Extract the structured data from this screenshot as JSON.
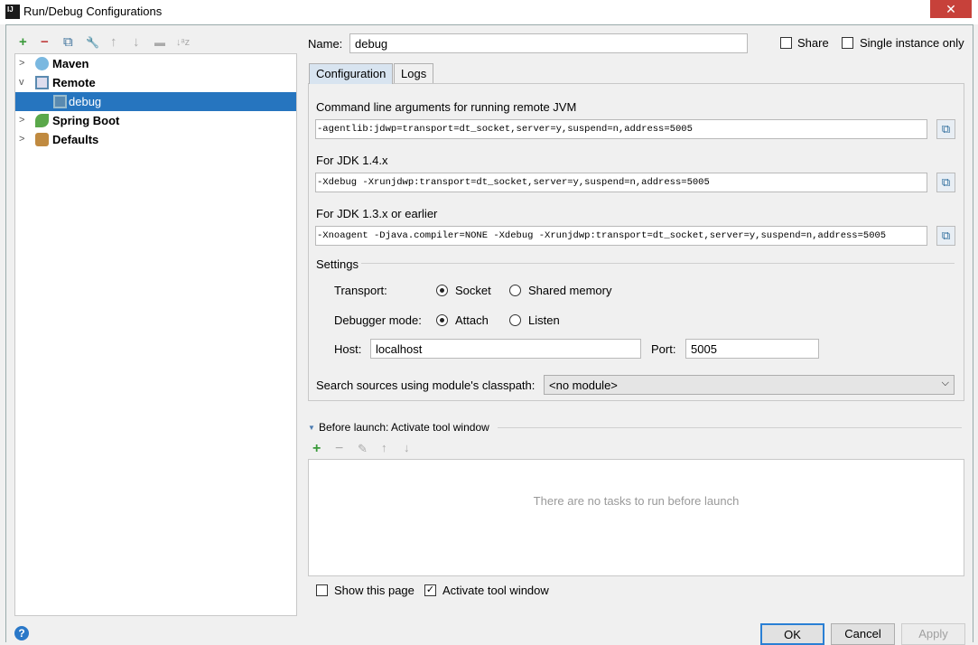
{
  "window": {
    "title": "Run/Debug Configurations",
    "app_icon": "IJ",
    "close": "✕"
  },
  "toolbar": {
    "add": "+",
    "remove": "−",
    "copy": "⧉",
    "edit_defaults": "🔧",
    "up": "↑",
    "down": "↓",
    "folder": "▬",
    "sort": "↓ᵃz"
  },
  "tree": [
    {
      "label": "Maven",
      "expanded": false,
      "icon": "maven-gear-icon"
    },
    {
      "label": "Remote",
      "expanded": true,
      "icon": "remote-icon"
    },
    {
      "label": "debug",
      "selected": true,
      "icon": "remote-icon"
    },
    {
      "label": "Spring Boot",
      "expanded": false,
      "icon": "spring-boot-icon"
    },
    {
      "label": "Defaults",
      "expanded": false,
      "icon": "wrench-icon"
    }
  ],
  "name": {
    "label": "Name:",
    "value": "debug"
  },
  "share": {
    "label": "Share",
    "checked": false
  },
  "single_instance": {
    "label": "Single instance only",
    "checked": false
  },
  "tabs": [
    "Configuration",
    "Logs"
  ],
  "config": {
    "cmd_label": "Command line arguments for running remote JVM",
    "cmd_value": "-agentlib:jdwp=transport=dt_socket,server=y,suspend=n,address=5005",
    "jdk14_label": "For JDK 1.4.x",
    "jdk14_value": "-Xdebug -Xrunjdwp:transport=dt_socket,server=y,suspend=n,address=5005",
    "jdk13_label": "For JDK 1.3.x or earlier",
    "jdk13_value": "-Xnoagent -Djava.compiler=NONE -Xdebug -Xrunjdwp:transport=dt_socket,server=y,suspend=n,address=5005",
    "settings_label": "Settings",
    "transport_label": "Transport:",
    "transport_options": [
      "Socket",
      "Shared memory"
    ],
    "transport_selected": "Socket",
    "debugger_mode_label": "Debugger mode:",
    "debugger_mode_options": [
      "Attach",
      "Listen"
    ],
    "debugger_mode_selected": "Attach",
    "host_label": "Host:",
    "host_value": "localhost",
    "port_label": "Port:",
    "port_value": "5005",
    "module_label": "Search sources using module's classpath:",
    "module_value": "<no module>"
  },
  "before_launch": {
    "title": "Before launch: Activate tool window",
    "empty": "There are no tasks to run before launch",
    "show_page": {
      "label": "Show this page",
      "checked": false
    },
    "activate": {
      "label": "Activate tool window",
      "checked": true
    }
  },
  "buttons": {
    "ok": "OK",
    "cancel": "Cancel",
    "apply": "Apply",
    "help": "?"
  }
}
